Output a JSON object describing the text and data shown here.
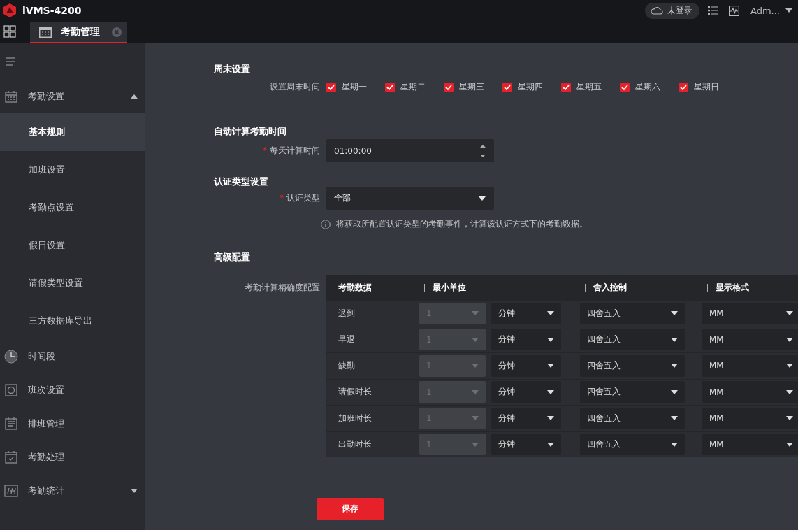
{
  "app": {
    "title": "iVMS-4200",
    "cloud_status": "未登录",
    "user": "Adm..."
  },
  "tabs": [
    {
      "label": "考勤管理",
      "selected": true
    }
  ],
  "sidebar": {
    "items": [
      {
        "label": "考勤设置",
        "kind": "calendar",
        "expanded": true,
        "children": [
          {
            "label": "基本规则",
            "selected": true
          },
          {
            "label": "加班设置",
            "selected": false
          },
          {
            "label": "考勤点设置",
            "selected": false
          },
          {
            "label": "假日设置",
            "selected": false
          },
          {
            "label": "请假类型设置",
            "selected": false
          },
          {
            "label": "三方数据库导出",
            "selected": false
          }
        ]
      },
      {
        "label": "时间段",
        "kind": "clock"
      },
      {
        "label": "班次设置",
        "kind": "shift"
      },
      {
        "label": "排班管理",
        "kind": "schedule"
      },
      {
        "label": "考勤处理",
        "kind": "check"
      },
      {
        "label": "考勤统计",
        "kind": "stats",
        "expanded": false
      }
    ]
  },
  "weekend": {
    "heading": "周末设置",
    "label": "设置周末时间",
    "days": [
      {
        "label": "星期一",
        "checked": true
      },
      {
        "label": "星期二",
        "checked": true
      },
      {
        "label": "星期三",
        "checked": true
      },
      {
        "label": "星期四",
        "checked": true
      },
      {
        "label": "星期五",
        "checked": true
      },
      {
        "label": "星期六",
        "checked": true
      },
      {
        "label": "星期日",
        "checked": true
      }
    ]
  },
  "auto_calc": {
    "heading": "自动计算考勤时间",
    "required_mark": "*",
    "label": "每天计算时间",
    "value": "01:00:00"
  },
  "auth": {
    "heading": "认证类型设置",
    "required_mark": "*",
    "label": "认证类型",
    "value": "全部",
    "info": "将获取所配置认证类型的考勤事件，计算该认证方式下的考勤数据。"
  },
  "advanced": {
    "heading": "高级配置",
    "label": "考勤计算精确度配置",
    "columns": [
      "考勤数据",
      "最小单位",
      "舍入控制",
      "显示格式"
    ],
    "rows": [
      {
        "name": "迟到",
        "unit_value": "1",
        "unit_value_disabled": true,
        "unit": "分钟",
        "rounding": "四舍五入",
        "format": "MM"
      },
      {
        "name": "早退",
        "unit_value": "1",
        "unit_value_disabled": true,
        "unit": "分钟",
        "rounding": "四舍五入",
        "format": "MM"
      },
      {
        "name": "缺勤",
        "unit_value": "1",
        "unit_value_disabled": true,
        "unit": "分钟",
        "rounding": "四舍五入",
        "format": "MM"
      },
      {
        "name": "请假时长",
        "unit_value": "1",
        "unit_value_disabled": true,
        "unit": "分钟",
        "rounding": "四舍五入",
        "format": "MM"
      },
      {
        "name": "加班时长",
        "unit_value": "1",
        "unit_value_disabled": true,
        "unit": "分钟",
        "rounding": "四舍五入",
        "format": "MM"
      },
      {
        "name": "出勤时长",
        "unit_value": "1",
        "unit_value_disabled": true,
        "unit": "分钟",
        "rounding": "四舍五入",
        "format": "MM"
      }
    ]
  },
  "footer": {
    "save": "保存"
  }
}
